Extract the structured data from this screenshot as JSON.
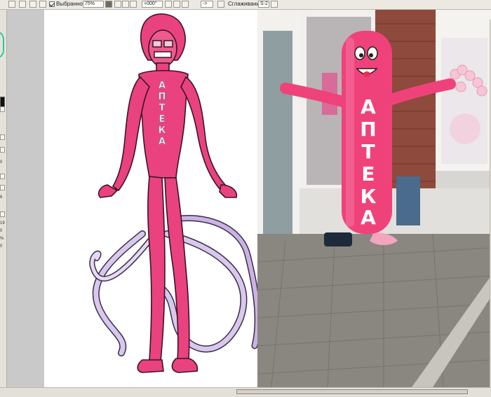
{
  "toolbar": {
    "favorites_label": "Выбранное",
    "zoom_value": "75%",
    "rotation_value": "+000°",
    "flip_value": "->",
    "smoothing_label": "Сглаживание",
    "smoothing_value": "S-2"
  },
  "left_dock": {
    "numbers": [
      "0",
      "6",
      "19",
      "0",
      "%",
      "0"
    ]
  },
  "canvas": {
    "sign_text": "АПТЕКА",
    "tube_sign_letters": [
      "А",
      "П",
      "Т",
      "Е",
      "К",
      "А"
    ]
  },
  "colors": {
    "character_pink": "#e9427f",
    "tube_pink": "#f0427a",
    "tail_lilac": "#d9c8ee",
    "brick": "#8e4a3c",
    "sidewalk": "#8a8680"
  },
  "icons": [
    "undo-icon",
    "redo-icon",
    "favorites-checkbox",
    "zoom-out-icon",
    "zoom-in-icon",
    "rotate-icon",
    "flip-icon",
    "brush-ring-icon"
  ]
}
